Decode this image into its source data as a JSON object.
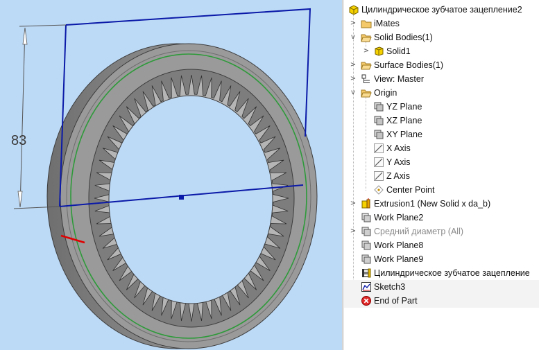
{
  "viewport": {
    "dimension_value": "83",
    "colors": {
      "background": "#bcd9f5",
      "sketch_line": "#0b1aa8",
      "pitch_circle": "#2e9a3a",
      "marker": "#e00000",
      "gear": "#8c8c8c"
    }
  },
  "browser": {
    "items": [
      {
        "label": "Цилиндрическое зубчатое зацепление2",
        "icon": "part-icon",
        "expander": "",
        "level": 0
      },
      {
        "label": "iMates",
        "icon": "folder-icon",
        "expander": ">",
        "level": 1
      },
      {
        "label": "Solid Bodies(1)",
        "icon": "folder-open-icon",
        "expander": "v",
        "level": 1
      },
      {
        "label": "Solid1",
        "icon": "solid-body-icon",
        "expander": ">",
        "level": 2
      },
      {
        "label": "Surface Bodies(1)",
        "icon": "folder-open-icon",
        "expander": ">",
        "level": 1
      },
      {
        "label": "View: Master",
        "icon": "view-icon",
        "expander": ">",
        "level": 1
      },
      {
        "label": "Origin",
        "icon": "folder-open-icon",
        "expander": "v",
        "level": 1
      },
      {
        "label": "YZ Plane",
        "icon": "plane-icon",
        "expander": "",
        "level": 2
      },
      {
        "label": "XZ Plane",
        "icon": "plane-icon",
        "expander": "",
        "level": 2
      },
      {
        "label": "XY Plane",
        "icon": "plane-icon",
        "expander": "",
        "level": 2
      },
      {
        "label": "X Axis",
        "icon": "axis-icon",
        "expander": "",
        "level": 2
      },
      {
        "label": "Y Axis",
        "icon": "axis-icon",
        "expander": "",
        "level": 2
      },
      {
        "label": "Z Axis",
        "icon": "axis-icon",
        "expander": "",
        "level": 2
      },
      {
        "label": "Center Point",
        "icon": "point-icon",
        "expander": "",
        "level": 2
      },
      {
        "label": "Extrusion1 (New Solid x da_b)",
        "icon": "extrusion-icon",
        "expander": ">",
        "level": 1
      },
      {
        "label": "Work Plane2",
        "icon": "work-plane-icon",
        "expander": "",
        "level": 1
      },
      {
        "label": "Средний диаметр (All)",
        "icon": "work-plane-icon",
        "expander": ">",
        "level": 1,
        "dim": true
      },
      {
        "label": "Work Plane8",
        "icon": "work-plane-icon",
        "expander": "",
        "level": 1
      },
      {
        "label": "Work Plane9",
        "icon": "work-plane-icon",
        "expander": "",
        "level": 1
      },
      {
        "label": "Цилиндрическое зубчатое зацепление",
        "icon": "gear-feature-icon",
        "expander": "",
        "level": 1
      },
      {
        "label": "Sketch3",
        "icon": "sketch-icon",
        "expander": "",
        "level": 1,
        "selected": true
      },
      {
        "label": "End of Part",
        "icon": "end-of-part-icon",
        "expander": "",
        "level": 1,
        "selected": true
      }
    ]
  }
}
